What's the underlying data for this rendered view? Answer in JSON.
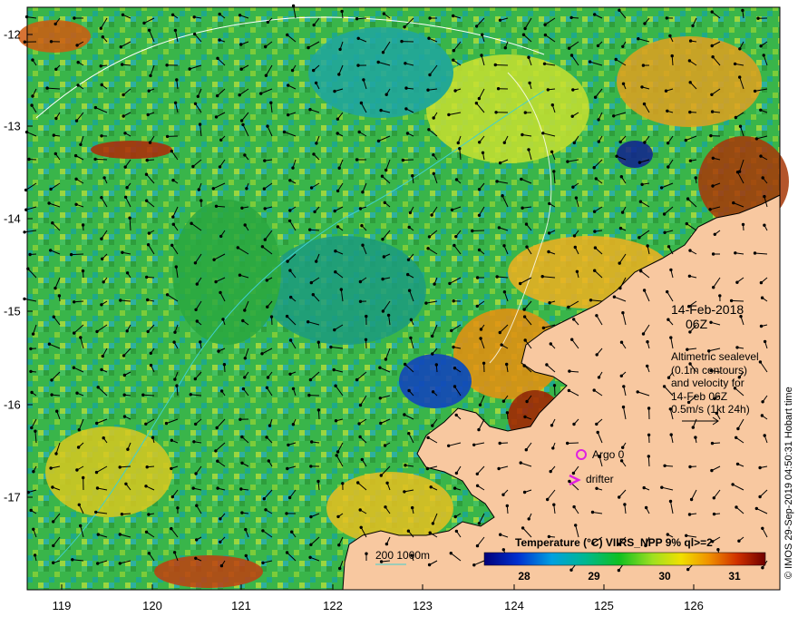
{
  "map": {
    "lat_ticks": [
      "-12",
      "-13",
      "-14",
      "-15",
      "-16",
      "-17"
    ],
    "lon_ticks": [
      "119",
      "120",
      "121",
      "122",
      "123",
      "124",
      "125",
      "126"
    ],
    "lat_range": [
      -17.9,
      -11.8
    ],
    "lon_range": [
      118.6,
      127.0
    ]
  },
  "annotations": {
    "date": "14-Feb-2018",
    "time": "06Z",
    "altimetry_lines": [
      "Altimetric sealevel",
      "(0.1m contours)",
      "and velocity for",
      "14-Feb 06Z",
      "0.5m/s (1kt 24h)"
    ],
    "argo_label": "Argo 0",
    "drifter_label": "drifter",
    "contour_label": "200  1000m",
    "credit": "© IMOS 29-Sep-2019 04:50:31 Hobart time"
  },
  "colorbar": {
    "title": "Temperature (°C) VIIRS_NPP 9% ql>=2",
    "ticks": [
      "28",
      "29",
      "30",
      "31"
    ],
    "range": [
      27.5,
      31.4
    ]
  },
  "colors": {
    "land": "#f8c8a0",
    "coast": "#000000",
    "argo_marker": "#e020e0",
    "drifter_marker": "#e020e0",
    "contour": "#40d0d0"
  }
}
